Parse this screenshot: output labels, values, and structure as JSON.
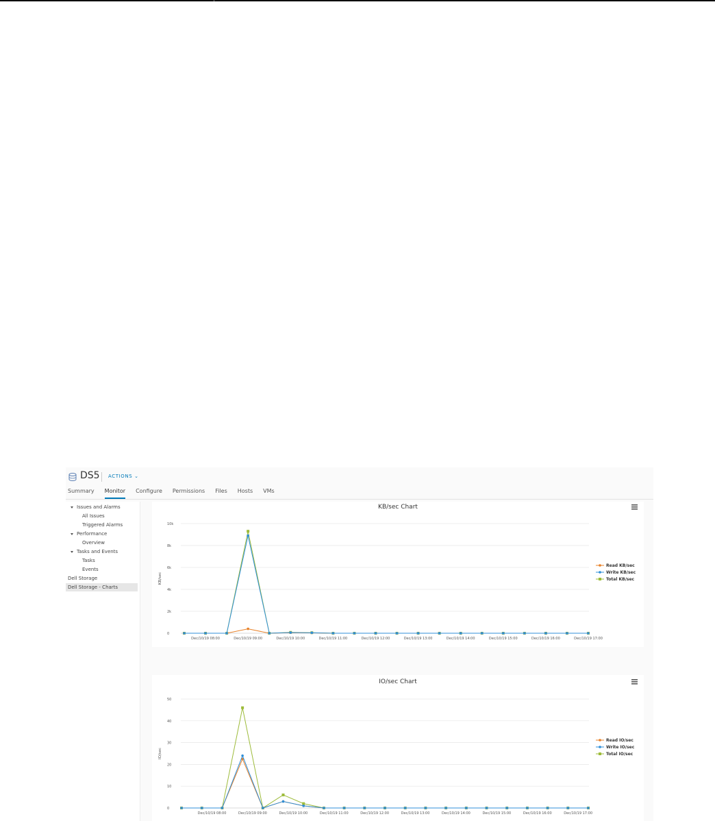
{
  "header": {
    "title": "DS5",
    "actions_label": "ACTIONS ⌄"
  },
  "tabs": [
    {
      "label": "Summary"
    },
    {
      "label": "Monitor",
      "active": true
    },
    {
      "label": "Configure"
    },
    {
      "label": "Permissions"
    },
    {
      "label": "Files"
    },
    {
      "label": "Hosts"
    },
    {
      "label": "VMs"
    }
  ],
  "sidebar": {
    "items": [
      {
        "label": "Issues and Alarms"
      },
      {
        "label": "All Issues"
      },
      {
        "label": "Triggered Alarms"
      },
      {
        "label": "Performance"
      },
      {
        "label": "Overview"
      },
      {
        "label": "Tasks and Events"
      },
      {
        "label": "Tasks"
      },
      {
        "label": "Events"
      },
      {
        "label": "Dell Storage"
      },
      {
        "label": "Dell Storage - Charts",
        "selected": true
      }
    ]
  },
  "colors": {
    "accent": "#0079b8",
    "read": "#e8822a",
    "write": "#2f8fd8",
    "total": "#9dbb3a"
  },
  "chart_data": [
    {
      "type": "line",
      "title": "KB/sec Chart",
      "ylabel": "KB/sec",
      "ylim": [
        0,
        10000
      ],
      "yticks": [
        0,
        2000,
        4000,
        6000,
        8000,
        10000
      ],
      "ytick_labels": [
        "0",
        "2k",
        "4k",
        "6k",
        "8k",
        "10k"
      ],
      "x": [
        0,
        1,
        2,
        3,
        4,
        5,
        6,
        7,
        8,
        9,
        10,
        11,
        12,
        13,
        14,
        15,
        16,
        17,
        18,
        19
      ],
      "xtick_positions": [
        1,
        3,
        5,
        7,
        9,
        11,
        13,
        15,
        17,
        19
      ],
      "xtick_labels": [
        "Dec/10/19 08:00",
        "Dec/10/19 09:00",
        "Dec/10/19 10:00",
        "Dec/10/19 11:00",
        "Dec/10/19 12:00",
        "Dec/10/19 13:00",
        "Dec/10/19 14:00",
        "Dec/10/19 15:00",
        "Dec/10/19 16:00",
        "Dec/10/19 17:00"
      ],
      "legend_position": "right",
      "grid": true,
      "series": [
        {
          "name": "Read KB/sec",
          "color": "#e8822a",
          "values": [
            0,
            0,
            0,
            400,
            0,
            50,
            30,
            0,
            0,
            0,
            0,
            0,
            0,
            0,
            0,
            0,
            0,
            0,
            0,
            0
          ]
        },
        {
          "name": "Write KB/sec",
          "color": "#2f8fd8",
          "values": [
            0,
            0,
            0,
            8900,
            0,
            60,
            40,
            0,
            0,
            0,
            0,
            0,
            0,
            0,
            0,
            0,
            0,
            0,
            0,
            0
          ]
        },
        {
          "name": "Total KB/sec",
          "color": "#9dbb3a",
          "values": [
            0,
            0,
            0,
            9300,
            0,
            80,
            50,
            0,
            0,
            0,
            0,
            0,
            0,
            0,
            0,
            0,
            0,
            0,
            0,
            0
          ]
        }
      ]
    },
    {
      "type": "line",
      "title": "IO/sec Chart",
      "ylabel": "IO/sec",
      "ylim": [
        0,
        50
      ],
      "yticks": [
        0,
        10,
        20,
        30,
        40,
        50
      ],
      "ytick_labels": [
        "0",
        "10",
        "20",
        "30",
        "40",
        "50"
      ],
      "x": [
        0,
        1,
        2,
        3,
        4,
        5,
        6,
        7,
        8,
        9,
        10,
        11,
        12,
        13,
        14,
        15,
        16,
        17,
        18,
        19,
        20
      ],
      "xtick_positions": [
        1.5,
        3.5,
        5.5,
        7.5,
        9.5,
        11.5,
        13.5,
        15.5,
        17.5,
        19.5
      ],
      "xtick_labels": [
        "Dec/10/19 08:00",
        "Dec/10/19 09:00",
        "Dec/10/19 10:00",
        "Dec/10/19 11:00",
        "Dec/10/19 12:00",
        "Dec/10/19 13:00",
        "Dec/10/19 14:00",
        "Dec/10/19 15:00",
        "Dec/10/19 16:00",
        "Dec/10/19 17:00"
      ],
      "legend_position": "right",
      "grid": true,
      "series": [
        {
          "name": "Read IO/sec",
          "color": "#e8822a",
          "values": [
            0,
            0,
            0,
            22.5,
            0,
            3,
            1,
            0,
            0,
            0,
            0,
            0,
            0,
            0,
            0,
            0,
            0,
            0,
            0,
            0,
            0
          ]
        },
        {
          "name": "Write IO/sec",
          "color": "#2f8fd8",
          "values": [
            0,
            0,
            0,
            24,
            0,
            3,
            1,
            0,
            0,
            0,
            0,
            0,
            0,
            0,
            0,
            0,
            0,
            0,
            0,
            0,
            0
          ]
        },
        {
          "name": "Total IO/sec",
          "color": "#9dbb3a",
          "values": [
            0,
            0,
            0,
            46,
            0,
            6,
            2,
            0,
            0,
            0,
            0,
            0,
            0,
            0,
            0,
            0,
            0,
            0,
            0,
            0,
            0
          ]
        }
      ]
    }
  ]
}
